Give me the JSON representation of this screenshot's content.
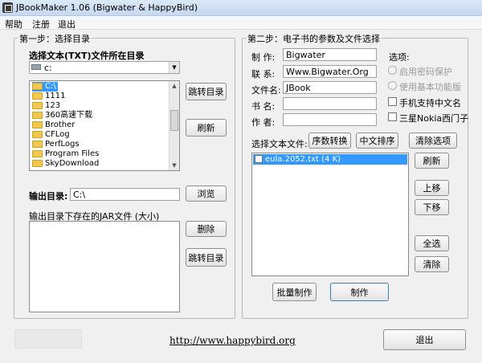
{
  "window": {
    "title": "JBookMaker 1.06 (Bigwater & HappyBird)"
  },
  "menu": [
    "帮助",
    "注册",
    "退出"
  ],
  "step1": {
    "title": "第一步：选择目录",
    "select_label": "选择文本(TXT)文件所在目录",
    "drive": "c:",
    "dirs": [
      "C:\\",
      "1111",
      "123",
      "360高速下载",
      "Brother",
      "CFLog",
      "PerfLogs",
      "Program Files",
      "SkyDownload"
    ],
    "jump_btn": "跳转目录",
    "refresh_btn": "刷新",
    "output_label": "输出目录:",
    "output_value": "C:\\",
    "browse_btn": "浏览",
    "jar_label": "输出目录下存在的JAR文件 (大小)",
    "delete_btn": "删除",
    "jump_btn2": "跳转目录"
  },
  "step2": {
    "title": "第二步：电子书的参数及文件选择",
    "author_label": "制  作:",
    "author_value": "Bigwater",
    "contact_label": "联  系:",
    "contact_value": "Www.Bigwater.Org",
    "filename_label": "文件名:",
    "filename_value": "JBook",
    "bookname_label": "书  名:",
    "bookname_value": "",
    "writer_label": "作  者:",
    "writer_value": "",
    "options_label": "选项:",
    "opt_password": "启用密码保护",
    "opt_basic": "使用基本功能版",
    "opt_chinese": "手机支持中文名",
    "opt_nokia": "三星Nokia西门子",
    "select_files_label": "选择文本文件:",
    "seq_btn": "序数转换",
    "sort_btn": "中文排序",
    "clear_btn": "清除选项",
    "files": [
      "eula.2052.txt (4 K)"
    ],
    "refresh_btn": "刷新",
    "up_btn": "上移",
    "down_btn": "下移",
    "select_all_btn": "全选",
    "clear_list_btn": "清除",
    "batch_btn": "批量制作",
    "make_btn": "制作"
  },
  "footer": {
    "url": "http://www.happybird.org",
    "exit_btn": "退出"
  }
}
